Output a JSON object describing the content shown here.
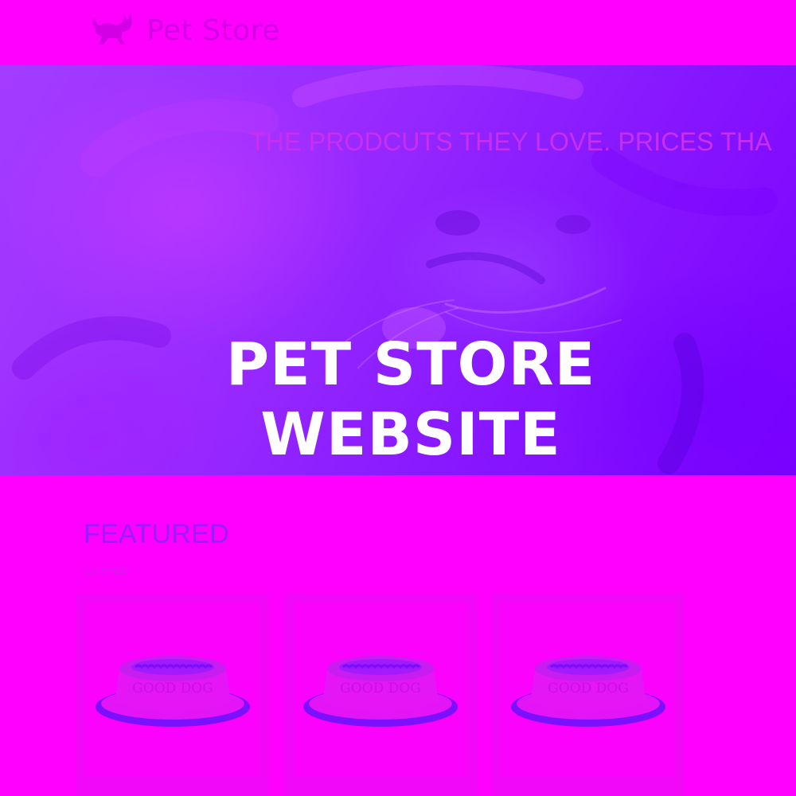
{
  "navbar": {
    "logo_text": "Pet Store",
    "logo_icon": "dog-icon"
  },
  "hero": {
    "tagline": "THE PRODCUTS THEY LOVE. PRICES THA",
    "title_line1": "PET STORE",
    "title_line2": "WEBSITE"
  },
  "featured": {
    "title": "FEATURED",
    "subtitle": "Lorem20",
    "products": [
      {
        "bowl_text": "GOOD DOG",
        "icon": "dog-bowl-icon"
      },
      {
        "bowl_text": "GOOD DOG",
        "icon": "dog-bowl-icon"
      },
      {
        "bowl_text": "GOOD DOG",
        "icon": "dog-bowl-icon"
      }
    ]
  },
  "colors": {
    "page_bg": "#ff00ff",
    "hero_bg": "#8a1cff",
    "logo": "#d300e6",
    "hero_title": "#ffffff",
    "featured_title": "#9c1cff"
  }
}
